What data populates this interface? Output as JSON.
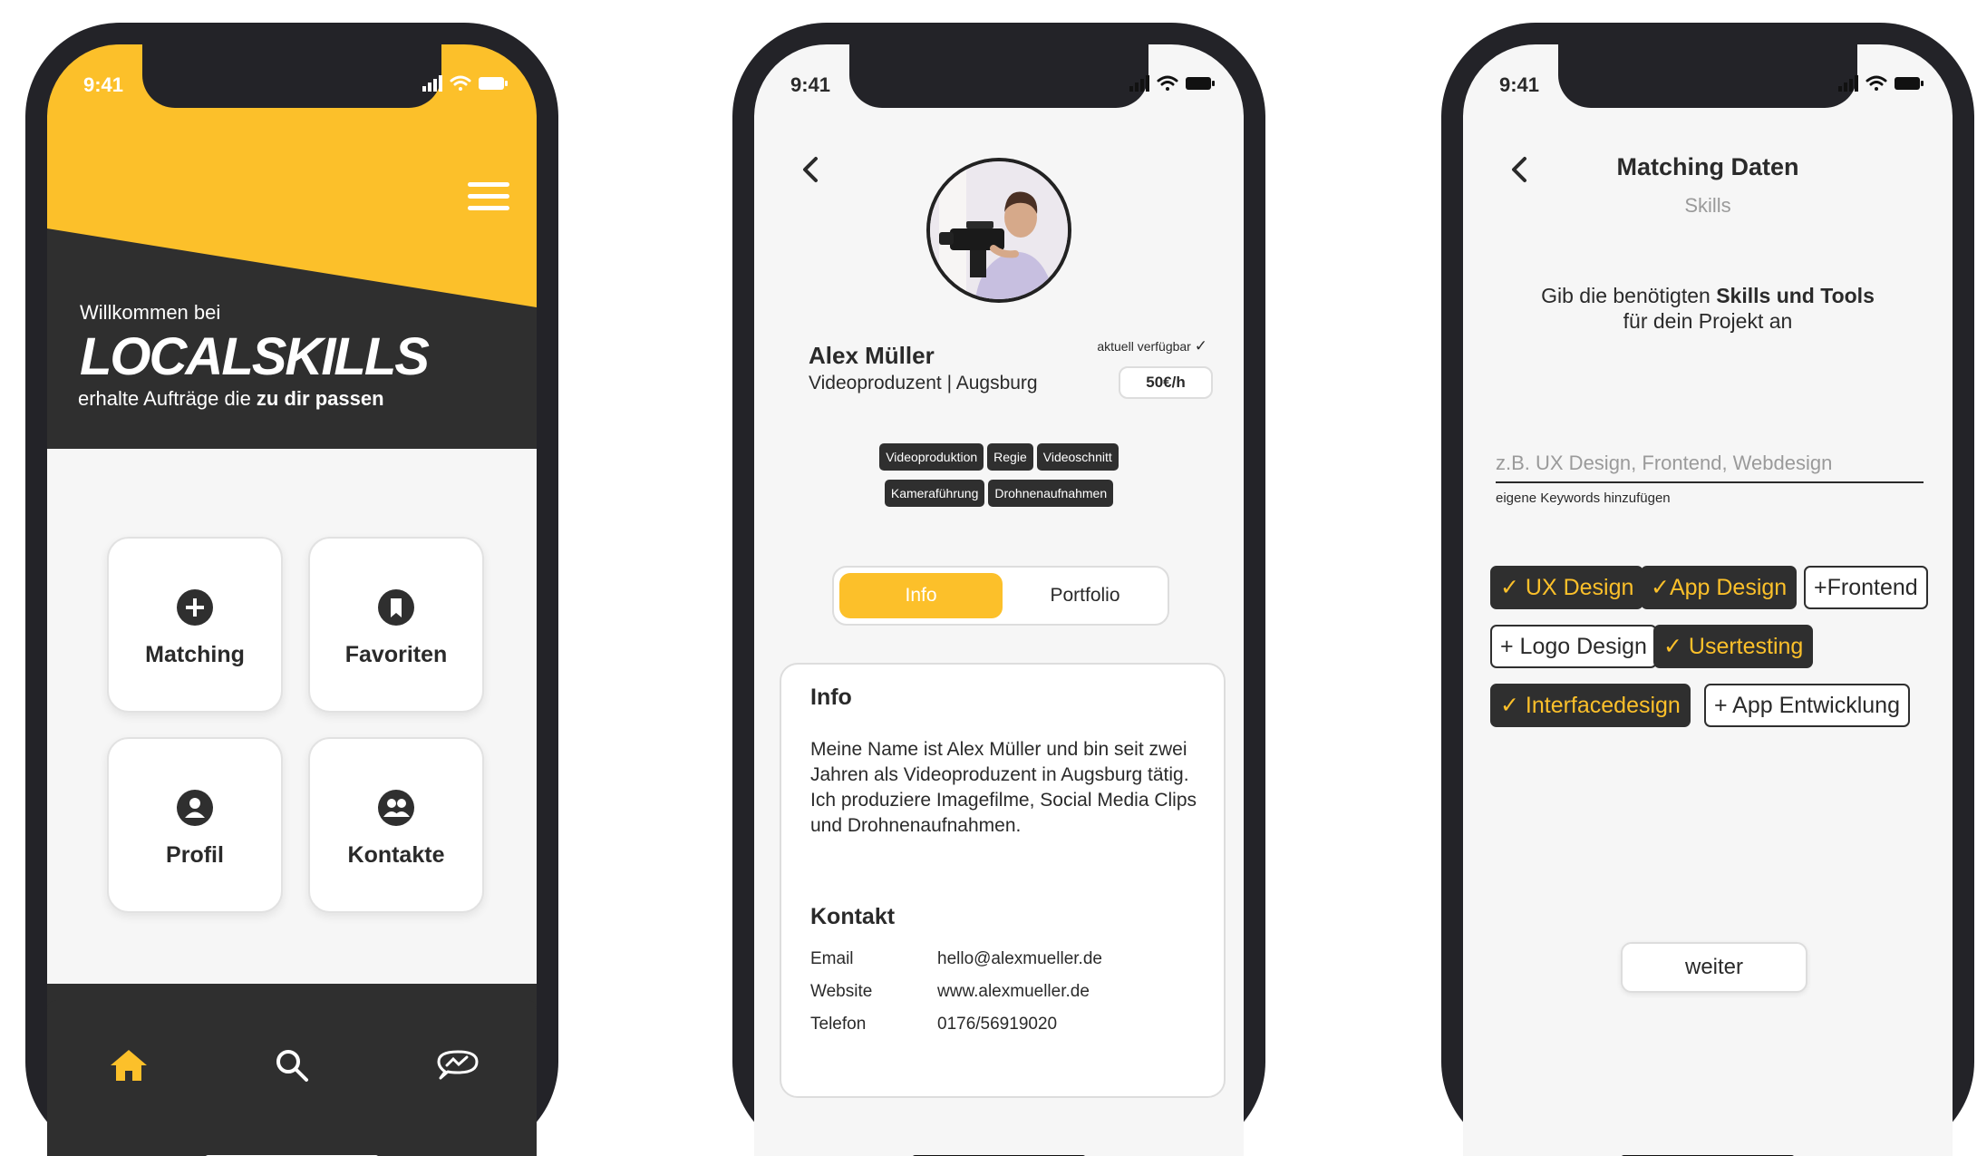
{
  "status_time": "9:41",
  "home": {
    "welcome": "Willkommen bei",
    "brand": "LOCALSKILLS",
    "tagline_prefix": "erhalte Aufträge die ",
    "tagline_bold": "zu dir passen",
    "tiles": [
      {
        "label": "Matching",
        "icon": "plus-circle-icon"
      },
      {
        "label": "Favoriten",
        "icon": "bookmark-icon"
      },
      {
        "label": "Profil",
        "icon": "user-icon"
      },
      {
        "label": "Kontakte",
        "icon": "users-icon"
      }
    ],
    "tabbar": {
      "active": "home",
      "icons": [
        "home-icon",
        "search-icon",
        "chat-icon"
      ]
    },
    "colors": {
      "accent": "#fcc02a",
      "dark": "#2f2f2f",
      "background": "#f6f6f6"
    }
  },
  "profile": {
    "name": "Alex Müller",
    "role": "Videoproduzent | Augsburg",
    "availability": "aktuell verfügbar",
    "rate": "50€/h",
    "skills": [
      "Videoproduktion",
      "Regie",
      "Videoschnitt",
      "Kameraführung",
      "Drohnenaufnahmen"
    ],
    "tabs": [
      {
        "label": "Info",
        "active": true
      },
      {
        "label": "Portfolio",
        "active": false
      }
    ],
    "info_title": "Info",
    "info_text": "Meine Name ist Alex Müller und bin seit zwei Jahren als Videoproduzent in Augsburg tätig. Ich produziere Imagefilme, Social Media Clips und Drohnenaufnahmen.",
    "contact_title": "Kontakt",
    "contact": [
      {
        "label": "Email",
        "value": "hello@alexmueller.de"
      },
      {
        "label": "Website",
        "value": "www.alexmueller.de"
      },
      {
        "label": "Telefon",
        "value": "0176/56919020"
      }
    ]
  },
  "matching": {
    "title": "Matching Daten",
    "subtitle": "Skills",
    "desc_part1": "Gib die benötigten ",
    "desc_bold": "Skills und Tools",
    "desc_part2": "für dein Projekt an",
    "input_placeholder": "z.B. UX Design, Frontend, Webdesign",
    "input_hint": "eigene Keywords hinzufügen",
    "tags": [
      {
        "label": "✓ UX Design",
        "selected": true
      },
      {
        "label": "✓App Design",
        "selected": true
      },
      {
        "label": "+Frontend",
        "selected": false
      },
      {
        "label": "+ Logo Design",
        "selected": false
      },
      {
        "label": "✓ Usertesting",
        "selected": true
      },
      {
        "label": "✓ Interfacedesign",
        "selected": true
      },
      {
        "label": "+ App Entwicklung",
        "selected": false
      }
    ],
    "next_button": "weiter"
  }
}
